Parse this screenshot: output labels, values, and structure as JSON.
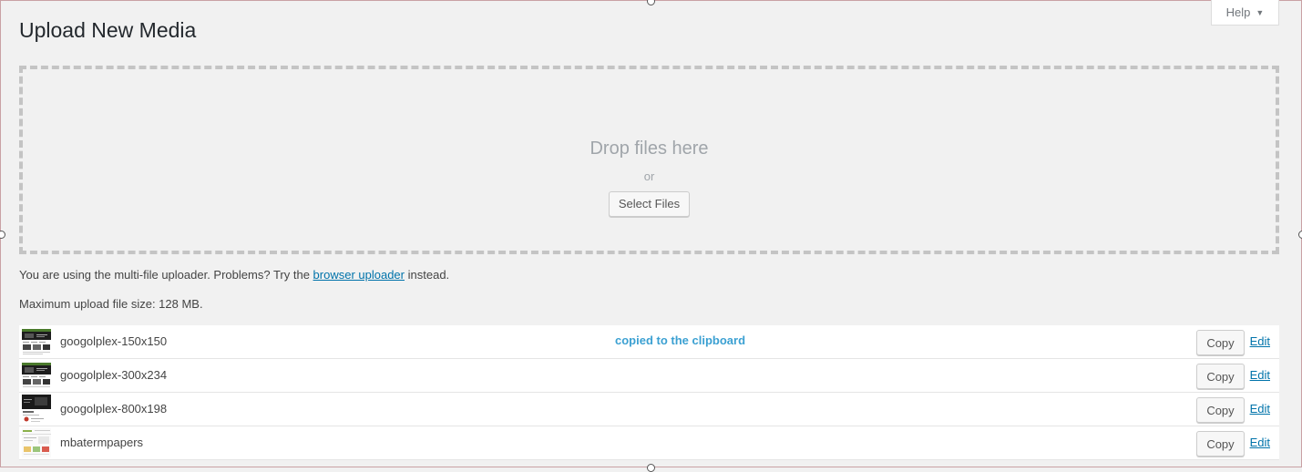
{
  "help": {
    "label": "Help",
    "caret": "▼"
  },
  "page": {
    "title": "Upload New Media"
  },
  "dropzone": {
    "title": "Drop files here",
    "or": "or",
    "select_label": "Select Files"
  },
  "info": {
    "prefix": "You are using the multi-file uploader. Problems? Try the",
    "link": "browser uploader",
    "suffix": "instead.",
    "max_size": "Maximum upload file size: 128 MB."
  },
  "items": [
    {
      "name": "googolplex-150x150",
      "status": "copied to the clipboard",
      "copy_label": "Copy",
      "edit_label": "Edit",
      "thumb": "dark-site"
    },
    {
      "name": "googolplex-300x234",
      "status": "",
      "copy_label": "Copy",
      "edit_label": "Edit",
      "thumb": "dark-site"
    },
    {
      "name": "googolplex-800x198",
      "status": "",
      "copy_label": "Copy",
      "edit_label": "Edit",
      "thumb": "dark-banner"
    },
    {
      "name": "mbatermpapers",
      "status": "",
      "copy_label": "Copy",
      "edit_label": "Edit",
      "thumb": "light-site"
    }
  ]
}
